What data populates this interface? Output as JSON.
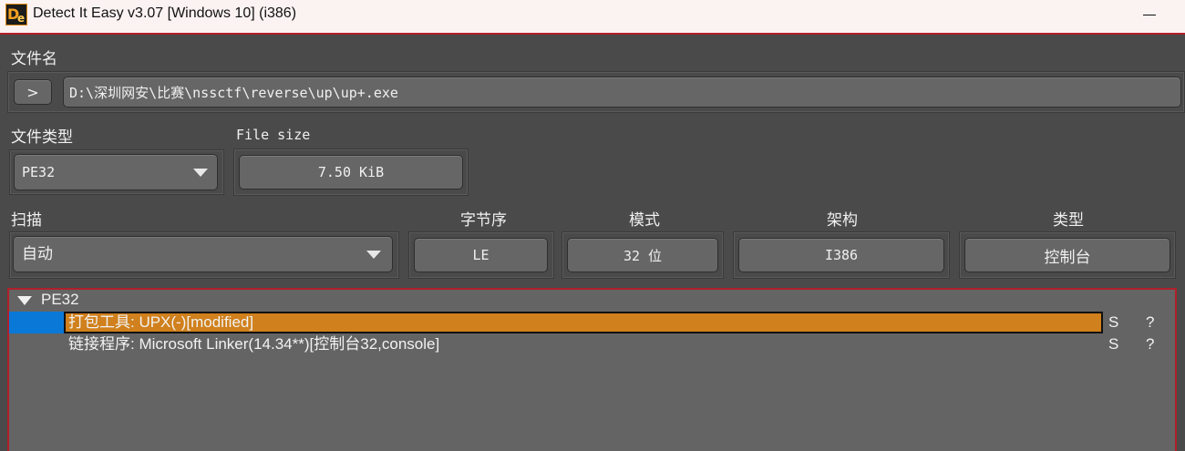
{
  "window": {
    "title": "Detect It Easy v3.07 [Windows 10] (i386)",
    "icon": "die-logo",
    "minimize_icon": "minimize-icon"
  },
  "file": {
    "label": "文件名",
    "browse_label": ">",
    "path": "D:\\深圳网安\\比赛\\nssctf\\reverse\\up\\up+.exe"
  },
  "file_type": {
    "label": "文件类型",
    "value": "PE32"
  },
  "file_size": {
    "label": "File size",
    "value": "7.50 KiB"
  },
  "scan": {
    "label": "扫描",
    "value": "自动"
  },
  "endianness": {
    "label": "字节序",
    "value": "LE"
  },
  "mode": {
    "label": "模式",
    "value": "32 位"
  },
  "arch": {
    "label": "架构",
    "value": "I386"
  },
  "type": {
    "label": "类型",
    "value": "控制台"
  },
  "results": {
    "root": "PE32",
    "rows": [
      {
        "text": "打包工具: UPX(-)[modified]",
        "s": "S",
        "q": "?",
        "selected": true
      },
      {
        "text": "链接程序: Microsoft Linker(14.34**)[控制台32,console]",
        "s": "S",
        "q": "?",
        "selected": false
      }
    ]
  },
  "colors": {
    "accent_border": "#b0202a",
    "selection_highlight": "#d0801c",
    "selection_marker": "#0a78d7"
  }
}
